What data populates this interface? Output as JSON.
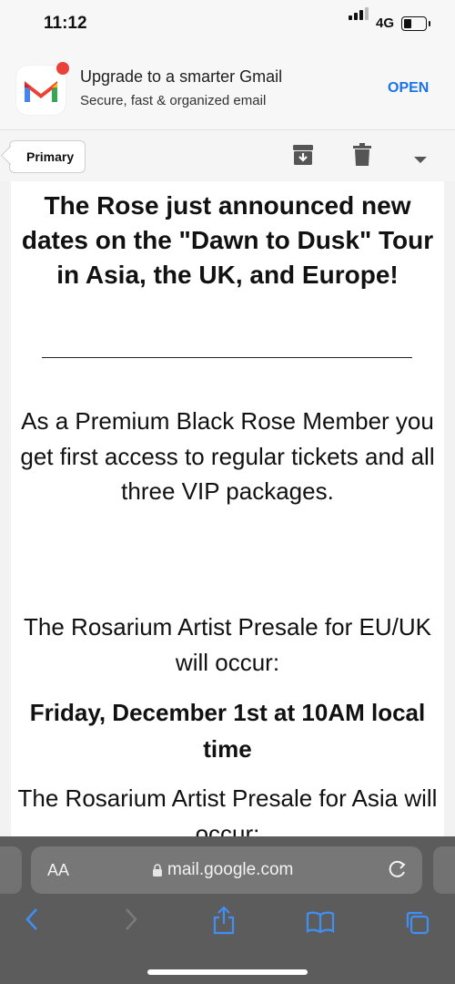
{
  "status_bar": {
    "time": "11:12",
    "network": "4G"
  },
  "banner": {
    "title": "Upgrade to a smarter Gmail",
    "subtitle": "Secure, fast & organized email",
    "open_label": "OPEN"
  },
  "toolbar": {
    "label_chip": "Primary"
  },
  "email": {
    "headline": "The Rose just announced new dates on the \"Dawn to Dusk\" Tour in Asia, the UK, and Europe!",
    "para1": "As a Premium Black Rose Member you get first access to regular tickets and all three VIP packages.",
    "para2": "The Rosarium Artist Presale for EU/UK will occur:",
    "date1": "Friday, December 1st at 10AM local time",
    "para3": "The Rosarium Artist Presale for Asia will occur:"
  },
  "browser": {
    "text_size_label": "AA",
    "url": "mail.google.com"
  },
  "colors": {
    "accent": "#1a73e8",
    "safari_bar": "#5c5c5c",
    "safari_icons": "#3f8ff5"
  },
  "icons": {
    "archive": "archive-icon",
    "delete": "trash-icon",
    "more": "chevron-down-icon",
    "back": "back-arrow-icon",
    "forward": "forward-arrow-icon",
    "share": "share-icon",
    "bookmarks": "bookmarks-icon",
    "tabs": "tabs-icon"
  }
}
